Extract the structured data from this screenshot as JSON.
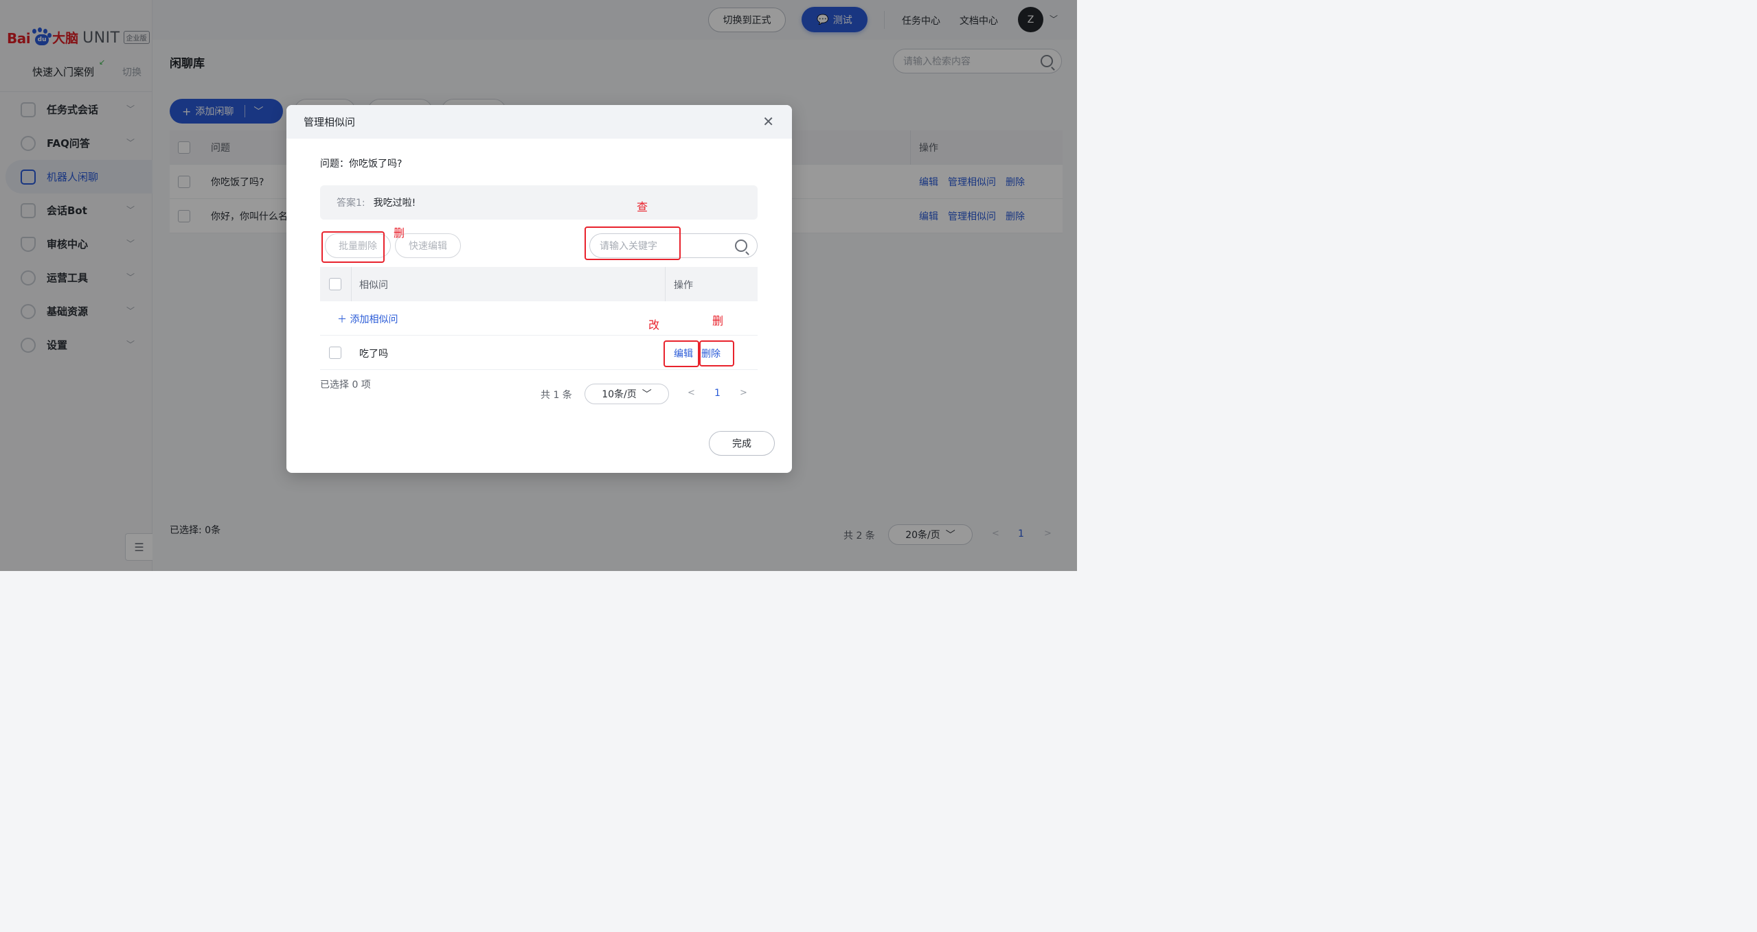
{
  "brand": {
    "logo_baidu": "Bai",
    "logo_du": "du",
    "logo_danao": "大脑",
    "logo_unit": "UNIT",
    "edition_badge": "企业版"
  },
  "sidebar": {
    "quick_start": "快速入门案例",
    "switch": "切换",
    "items": [
      {
        "label": "任务式会话",
        "icon": "task-icon"
      },
      {
        "label": "FAQ问答",
        "icon": "faq-icon"
      },
      {
        "label": "机器人闲聊",
        "icon": "chat-icon",
        "active": true
      },
      {
        "label": "会话Bot",
        "icon": "bot-icon"
      },
      {
        "label": "审核中心",
        "icon": "shield-icon"
      },
      {
        "label": "运营工具",
        "icon": "tools-icon"
      },
      {
        "label": "基础资源",
        "icon": "resources-icon"
      },
      {
        "label": "设置",
        "icon": "gear-icon"
      }
    ]
  },
  "topbar": {
    "switch_formal": "切换到正式",
    "test": "测试",
    "task_center": "任务中心",
    "doc_center": "文档中心",
    "avatar_letter": "Z"
  },
  "page": {
    "title": "闲聊库",
    "search_placeholder": "请输入检索内容",
    "add_button": "添加闲聊",
    "columns": {
      "question": "问题",
      "actions": "操作"
    },
    "rows": [
      {
        "question": "你吃饭了吗?",
        "actions": [
          "编辑",
          "管理相似问",
          "删除"
        ]
      },
      {
        "question": "你好，你叫什么名",
        "actions": [
          "编辑",
          "管理相似问",
          "删除"
        ]
      }
    ],
    "selected": "已选择: 0条",
    "total": "共 2 条",
    "page_size": "20条/页",
    "current_page": "1"
  },
  "modal": {
    "title": "管理相似问",
    "question_label": "问题：你吃饭了吗?",
    "answer_key": "答案1:",
    "answer_value": "我吃过啦!",
    "batch_delete": "批量删除",
    "quick_edit": "快速编辑",
    "keyword_placeholder": "请输入关键字",
    "columns": {
      "similar": "相似问",
      "actions": "操作"
    },
    "add_similar": "添加相似问",
    "rows": [
      {
        "text": "吃了吗",
        "edit": "编辑",
        "delete": "删除"
      }
    ],
    "selected": "已选择 0 项",
    "total": "共 1 条",
    "page_size": "10条/页",
    "current_page": "1",
    "done": "完成"
  },
  "annotations": {
    "query": "查",
    "delete_batch": "删",
    "edit": "改",
    "delete_row": "删"
  },
  "colors": {
    "primary": "#2a5bd7",
    "annotation_red": "#e8222c",
    "brand_red": "#de1f26"
  }
}
